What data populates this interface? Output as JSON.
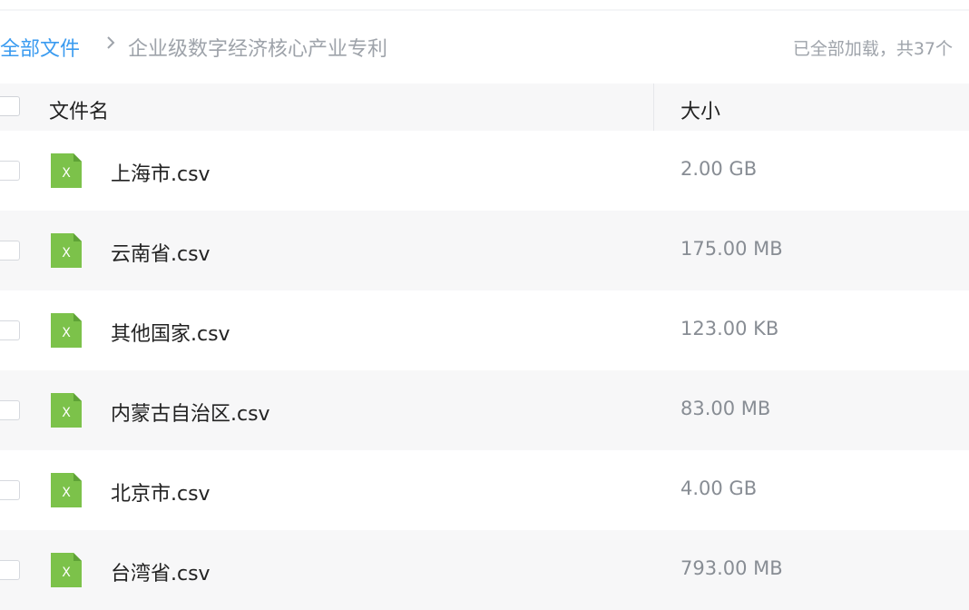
{
  "breadcrumb": {
    "root": "全部文件",
    "separator_icon": "chevron-right-icon",
    "current": "企业级数字经济核心产业专利"
  },
  "status": "已全部加载，共37个",
  "table": {
    "columns": {
      "name": "文件名",
      "size": "大小"
    },
    "file_icon": "excel-file-icon",
    "icon_color": "#7cc24a",
    "rows": [
      {
        "name": "上海市.csv",
        "size": "2.00 GB"
      },
      {
        "name": "云南省.csv",
        "size": "175.00 MB"
      },
      {
        "name": "其他国家.csv",
        "size": "123.00 KB"
      },
      {
        "name": "内蒙古自治区.csv",
        "size": "83.00 MB"
      },
      {
        "name": "北京市.csv",
        "size": "4.00 GB"
      },
      {
        "name": "台湾省.csv",
        "size": "793.00 MB"
      }
    ]
  },
  "colors": {
    "accent": "#3a9bf0",
    "muted": "#9ea3aa"
  }
}
